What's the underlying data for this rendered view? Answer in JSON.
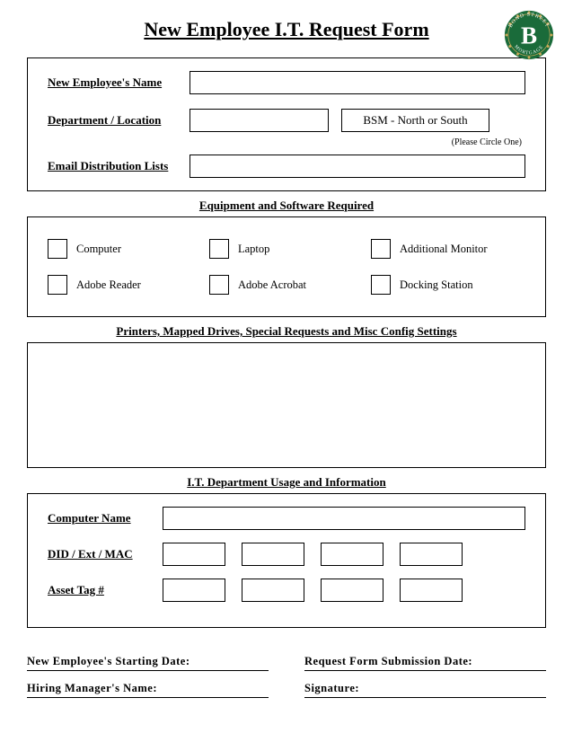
{
  "title": "New Employee I.T. Request Form",
  "logo": {
    "letter": "B",
    "text_top": "BOND STREET",
    "text_bottom": "MORTGAGE"
  },
  "section1": {
    "name_label": "New Employee's Name",
    "dept_label": "Department / Location",
    "bsm_text": "BSM - North or South",
    "circle_note": "(Please Circle One)",
    "email_label": "Email Distribution Lists"
  },
  "section2": {
    "header": "Equipment and Software Required",
    "items": [
      "Computer",
      "Laptop",
      "Additional Monitor",
      "Adobe Reader",
      "Adobe Acrobat",
      "Docking Station"
    ]
  },
  "section3": {
    "header": "Printers, Mapped Drives, Special Requests and Misc Config Settings"
  },
  "section4": {
    "header": "I.T. Department Usage and Information",
    "computer_label": "Computer Name",
    "did_label": "DID / Ext / MAC",
    "asset_label": "Asset Tag #"
  },
  "footer": {
    "start_date": "New  Employee's  Starting  Date:",
    "submit_date": "Request  Form  Submission  Date:",
    "manager": "Hiring Manager's Name:",
    "signature": "Signature:"
  }
}
